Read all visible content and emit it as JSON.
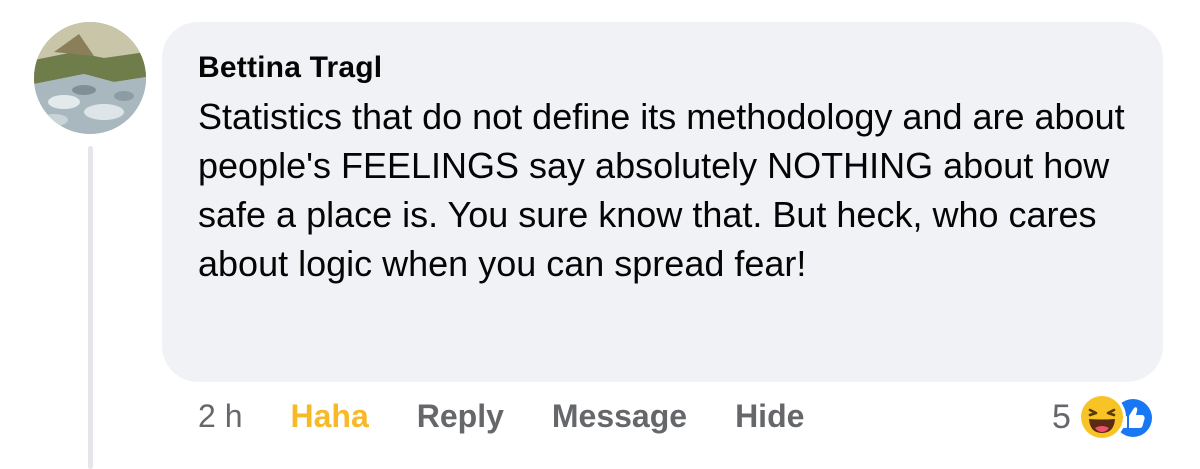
{
  "comment": {
    "author": "Bettina Tragl",
    "text": "Statistics that do not define its methodology and are about people's FEELINGS say absolutely NOTHING about how safe a place is. You sure know that. But heck, who cares about logic when you can spread fear!",
    "avatar_icon": "avatar-photo"
  },
  "actions": {
    "timestamp": "2 h",
    "reaction_label": "Haha",
    "reply_label": "Reply",
    "message_label": "Message",
    "hide_label": "Hide"
  },
  "reactions": {
    "count": "5",
    "icons": [
      "haha-icon",
      "like-icon"
    ]
  },
  "colors": {
    "bubble": "#f0f2f5",
    "haha": "#f7b928",
    "secondary_text": "#65676b",
    "like_blue": "#1877f2"
  }
}
